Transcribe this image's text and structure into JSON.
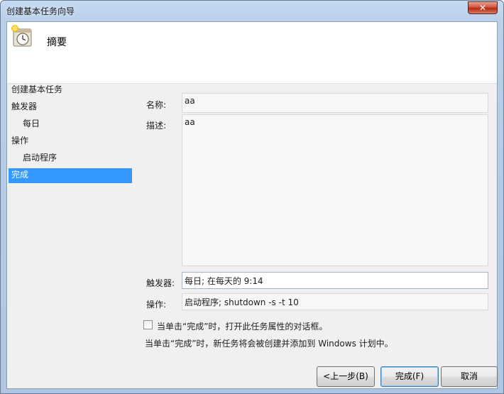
{
  "window": {
    "title": "创建基本任务向导",
    "close_label": "✕"
  },
  "header": {
    "title": "摘要",
    "icon": "clock-task-icon"
  },
  "sidebar": {
    "items": [
      {
        "label": "创建基本任务"
      },
      {
        "label": "触发器"
      },
      {
        "label": "每日"
      },
      {
        "label": "操作"
      },
      {
        "label": "启动程序"
      },
      {
        "label": "完成"
      }
    ],
    "selected": "完成",
    "selected_color": "#3399ff"
  },
  "form": {
    "name_label": "名称:",
    "name_value": "aa",
    "description_label": "描述:",
    "description_value": "aa",
    "trigger_label": "触发器:",
    "trigger_value": "每日; 在每天的 9:14",
    "action_label": "操作:",
    "action_value": "启动程序; shutdown -s -t 10"
  },
  "checkbox": {
    "label": "当单击“完成”时，打开此任务属性的对话框。",
    "checked": false
  },
  "note": "当单击“完成”时，新任务将会被创建并添加到 Windows 计划中。",
  "buttons": {
    "back": "<上一步(B)",
    "finish": "完成(F)",
    "cancel": "取消"
  }
}
